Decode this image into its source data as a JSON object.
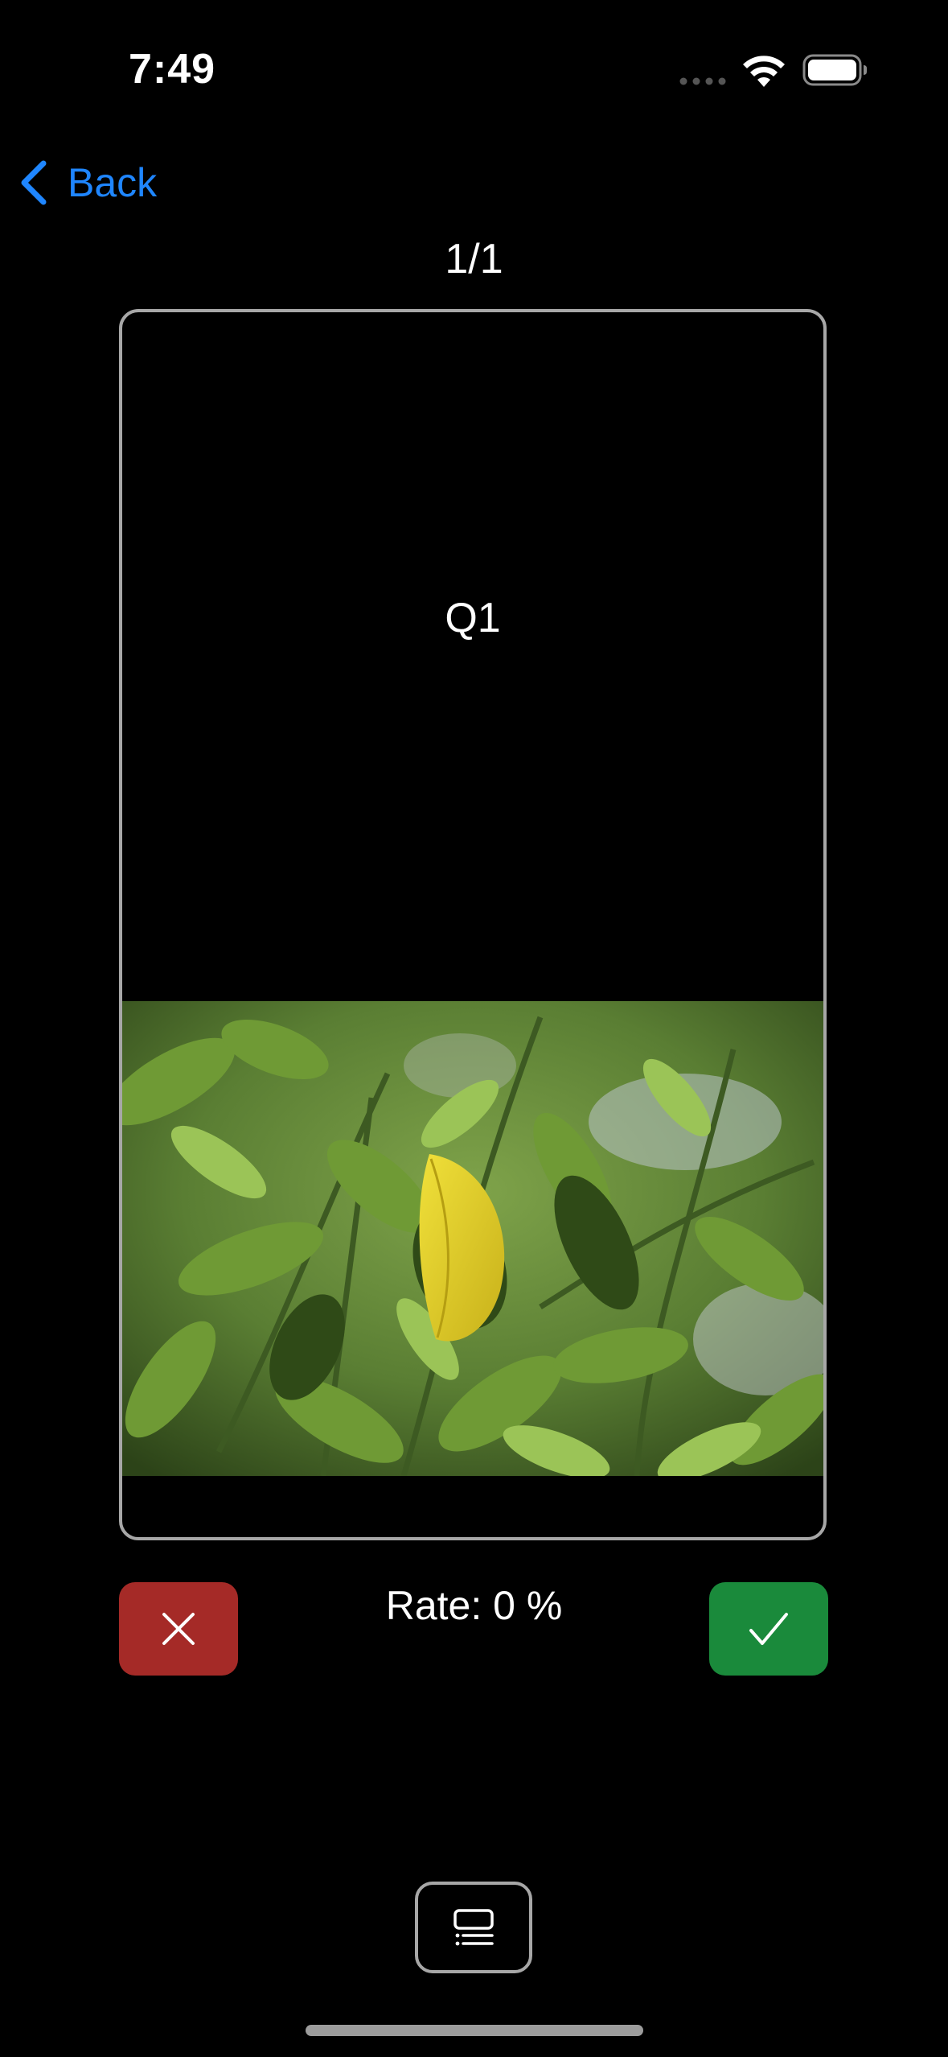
{
  "status_bar": {
    "time": "7:49",
    "icons": [
      "signal-dots-icon",
      "wifi-icon",
      "battery-icon"
    ]
  },
  "nav": {
    "back_label": "Back",
    "back_icon": "chevron-left-icon"
  },
  "counter": "1/1",
  "card": {
    "question": "Q1",
    "image": "photo of green citrus leaves with one yellow leaf"
  },
  "controls": {
    "rate_text": "Rate: 0 %",
    "wrong_icon": "xmark-icon",
    "right_icon": "checkmark-icon",
    "list_icon": "list-icon"
  },
  "colors": {
    "accent_blue": "#1f86ff",
    "wrong_red": "#a52a27",
    "right_green": "#1a8a3b",
    "border_gray": "#a7a7a7"
  }
}
